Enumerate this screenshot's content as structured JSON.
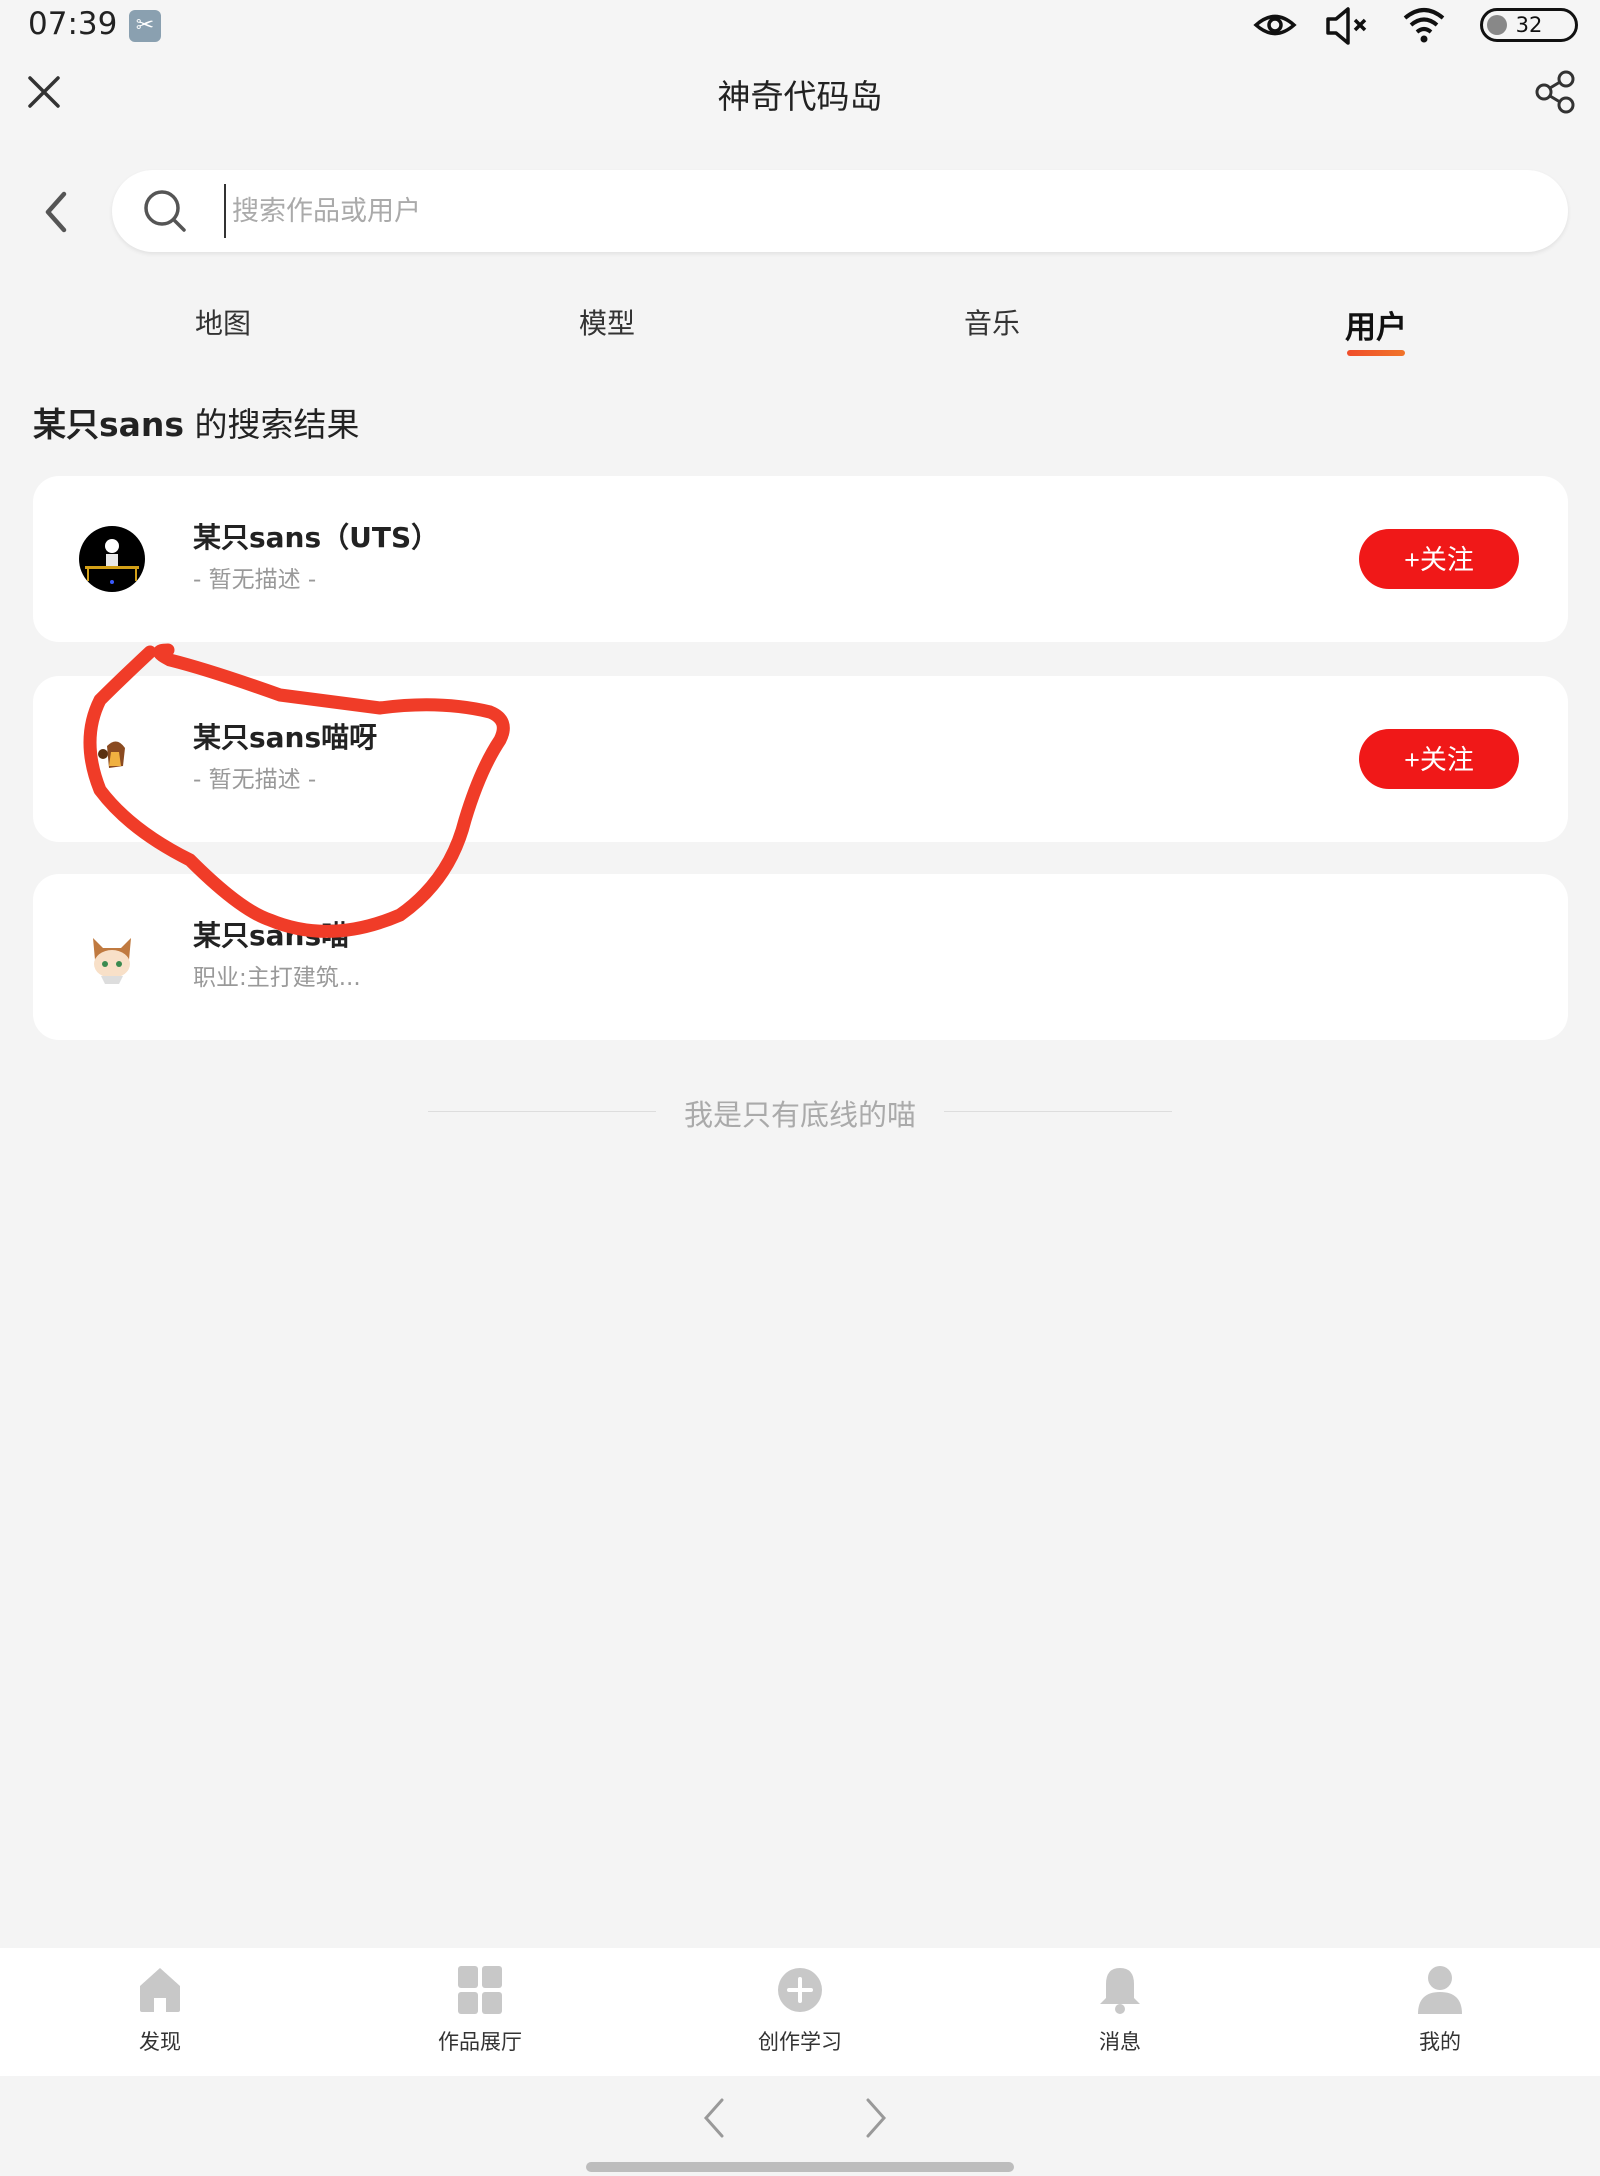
{
  "status_bar": {
    "time": "07:39",
    "battery": "32"
  },
  "header": {
    "title": "神奇代码岛"
  },
  "search": {
    "placeholder": "搜索作品或用户",
    "value": ""
  },
  "tabs": [
    {
      "label": "地图",
      "active": false
    },
    {
      "label": "模型",
      "active": false
    },
    {
      "label": "音乐",
      "active": false
    },
    {
      "label": "用户",
      "active": true
    }
  ],
  "results": {
    "query": "某只sans",
    "suffix": " 的搜索结果"
  },
  "users": [
    {
      "name": "某只sans（UTS）",
      "desc": "- 暂无描述 -",
      "follow_label": "+关注"
    },
    {
      "name": "某只sans喵呀",
      "desc": "- 暂无描述 -",
      "follow_label": "+关注"
    },
    {
      "name": "某只sans喵",
      "desc": "职业:主打建筑..."
    }
  ],
  "end_text": "我是只有底线的喵",
  "bottom_nav": [
    {
      "label": "发现",
      "icon": "home-icon"
    },
    {
      "label": "作品展厅",
      "icon": "grid-icon"
    },
    {
      "label": "创作学习",
      "icon": "plus-circle-icon"
    },
    {
      "label": "消息",
      "icon": "bell-icon"
    },
    {
      "label": "我的",
      "icon": "user-icon"
    }
  ],
  "colors": {
    "accent": "#f01818",
    "tab_underline": "#f04d2a",
    "annotation": "#f03c28"
  }
}
